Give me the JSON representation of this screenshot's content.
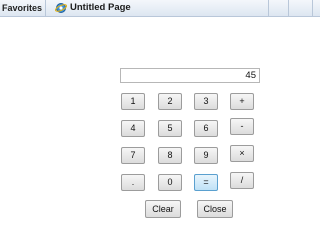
{
  "browser": {
    "favorites_label": "Favorites",
    "tab_title": "Untitled Page"
  },
  "calculator": {
    "display_value": "45",
    "keys": {
      "k1": "1",
      "k2": "2",
      "k3": "3",
      "plus": "+",
      "k4": "4",
      "k5": "5",
      "k6": "6",
      "minus": "-",
      "k7": "7",
      "k8": "8",
      "k9": "9",
      "multiply": "×",
      "dot": ".",
      "k0": "0",
      "equals": "=",
      "divide": "/"
    },
    "clear_label": "Clear",
    "close_label": "Close"
  },
  "colors": {
    "equals_highlight": "#bfe1f6",
    "browser_bar": "#dde6f1"
  }
}
